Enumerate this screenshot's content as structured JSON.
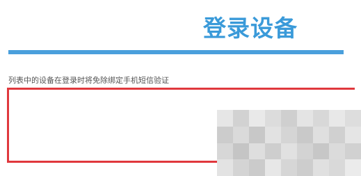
{
  "header": {
    "title": "登录设备"
  },
  "description": "列表中的设备在登录时将免除绑定手机短信验证",
  "device_list": {
    "items": []
  },
  "colors": {
    "title": "#3a9ad9",
    "underline": "#4a9fdc",
    "box_border": "#e0383d",
    "description_text": "#555555"
  },
  "icons": {
    "obscured_region": "pixelated-mosaic-image"
  }
}
